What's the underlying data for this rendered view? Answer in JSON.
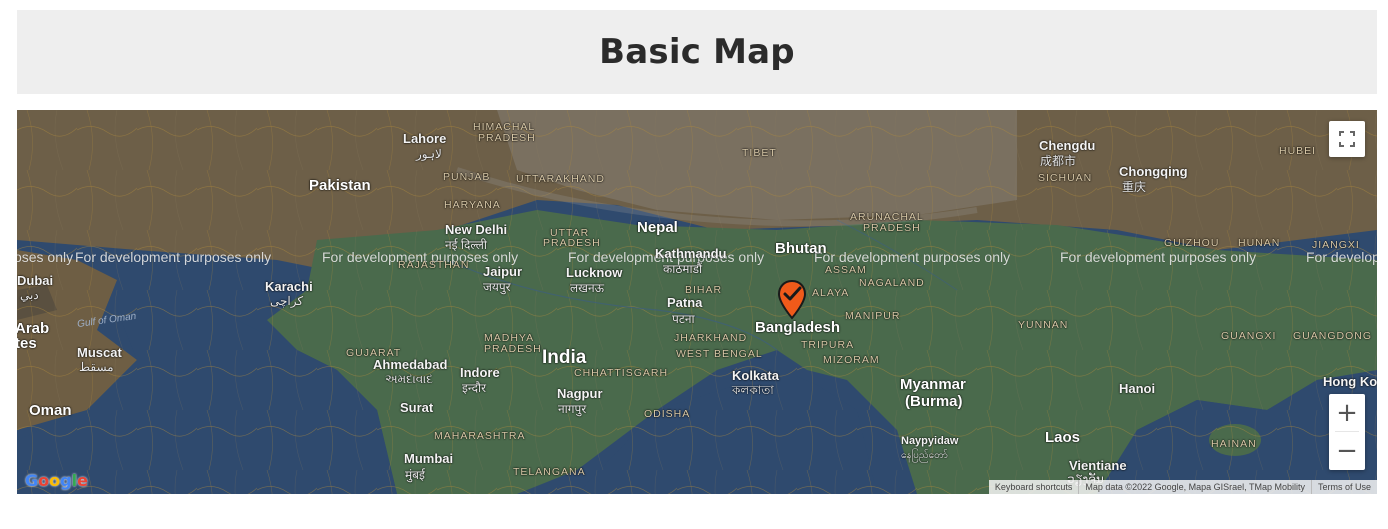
{
  "page": {
    "title": "Basic Map"
  },
  "map": {
    "watermark_text": "For development purposes only",
    "marker": {
      "icon": "checkmark-pin-icon",
      "color": "#f05a1a",
      "location": "Bangladesh"
    },
    "labels": {
      "countries": {
        "pakistan": "Pakistan",
        "nepal": "Nepal",
        "bhutan": "Bhutan",
        "bangladesh": "Bangladesh",
        "india": "India",
        "myanmar": "Myanmar",
        "myanmar_alt": "(Burma)",
        "laos": "Laos",
        "oman": "Oman",
        "arab": "Arab",
        "ates": "tes"
      },
      "cities": {
        "lahore": "Lahore",
        "lahore_native": "لاہور",
        "new_delhi": "New Delhi",
        "new_delhi_native": "नई दिल्ली",
        "karachi": "Karachi",
        "karachi_native": "کراچی",
        "jaipur": "Jaipur",
        "jaipur_native": "जयपुर",
        "lucknow": "Lucknow",
        "lucknow_native": "लखनऊ",
        "kathmandu": "Kathmandu",
        "kathmandu_native": "काठमाडौं",
        "patna": "Patna",
        "patna_native": "पटना",
        "ahmedabad": "Ahmedabad",
        "ahmedabad_native": "અમદાવાદ",
        "indore": "Indore",
        "indore_native": "इन्दौर",
        "nagpur": "Nagpur",
        "nagpur_native": "नागपुर",
        "kolkata": "Kolkata",
        "kolkata_native": "কলকাতা",
        "surat": "Surat",
        "mumbai": "Mumbai",
        "mumbai_native": "मुंबई",
        "muscat": "Muscat",
        "muscat_native": "مسقط",
        "dubai": "Dubai",
        "dubai_native": "دبي",
        "chengdu": "Chengdu",
        "chengdu_native": "成都市",
        "chongqing": "Chongqing",
        "chongqing_native": "重庆",
        "hanoi": "Hanoi",
        "hong_kong": "Hong Kor",
        "naypyidaw": "Naypyidaw",
        "naypyidaw_native": "နေပြည်တော်",
        "vientiane": "Vientiane",
        "vientiane_native": "ວຽງຈັນ"
      },
      "regions": {
        "himachal": "HIMACHAL",
        "pradesh1": "PRADESH",
        "punjab": "PUNJAB",
        "uttarakhand": "UTTARAKHAND",
        "haryana": "HARYANA",
        "rajasthan": "RAJASTHAN",
        "uttar": "UTTAR",
        "pradesh2": "PRADESH",
        "tibet": "TIBET",
        "arunachal": "ARUNACHAL",
        "pradesh3": "PRADESH",
        "assam": "ASSAM",
        "nagaland": "NAGALAND",
        "meghalaya": "ALAYA",
        "manipur": "MANIPUR",
        "tripura": "TRIPURA",
        "mizoram": "MIZORAM",
        "bihar": "BIHAR",
        "jharkhand": "JHARKHAND",
        "west_bengal": "WEST BENGAL",
        "madhya": "MADHYA",
        "pradesh4": "PRADESH",
        "gujarat": "GUJARAT",
        "chhattisgarh": "CHHATTISGARH",
        "odisha": "ODISHA",
        "maharashtra": "MAHARASHTRA",
        "telangana": "TELANGANA",
        "sichuan": "SICHUAN",
        "hubei": "HUBEI",
        "guizhou": "GUIZHOU",
        "hunan": "HUNAN",
        "jiangxi": "JIANGXI",
        "yunnan": "YUNNAN",
        "guangxi": "GUANGXI",
        "guangdong": "GUANGDONG",
        "hainan": "HAINAN"
      },
      "water": {
        "gulf_of_oman": "Gulf of Oman"
      }
    },
    "controls": {
      "fullscreen_icon": "fullscreen-icon",
      "zoom_in": "+",
      "zoom_out": "−"
    },
    "attribution": {
      "keyboard": "Keyboard shortcuts",
      "data": "Map data ©2022 Google, Mapa GISrael, TMap Mobility",
      "terms": "Terms of Use"
    },
    "logo": {
      "g1": "G",
      "o1": "o",
      "o2": "o",
      "g2": "g",
      "l": "l",
      "e": "e"
    }
  }
}
